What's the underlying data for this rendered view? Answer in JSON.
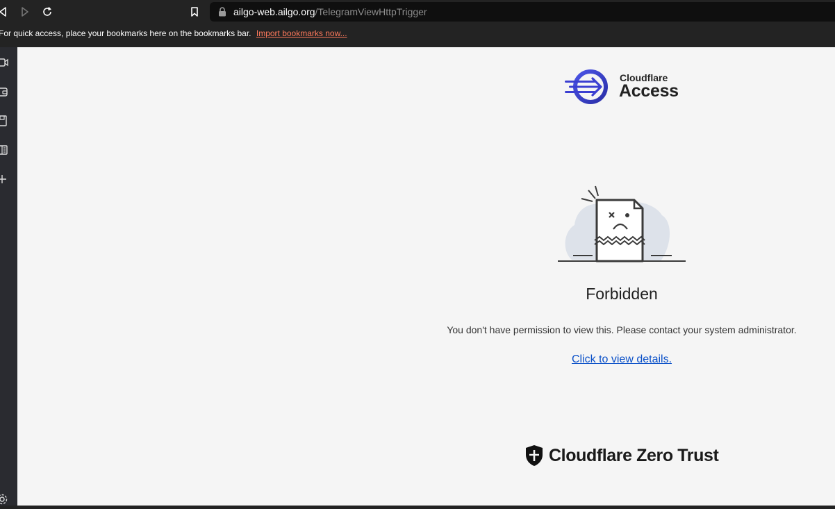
{
  "browser": {
    "url_host": "ailgo-web.ailgo.org",
    "url_path": "/TelegramViewHttpTrigger",
    "icons": [
      "back-icon",
      "forward-icon",
      "reload-icon",
      "bookmark-icon",
      "lock-icon"
    ]
  },
  "bookmarks_bar": {
    "message": "For quick access, place your bookmarks here on the bookmarks bar.",
    "import_link": "Import bookmarks now..."
  },
  "sidebar": {
    "icons": [
      "video-icon",
      "wallet-icon",
      "save-icon",
      "reader-icon",
      "add-icon",
      "settings-icon"
    ]
  },
  "page": {
    "logo_brand": "Cloudflare",
    "logo_product": "Access",
    "title": "Forbidden",
    "message": "You don't have permission to view this. Please contact your system administrator.",
    "details_link": "Click to view details.",
    "footer_logo": "Cloudflare Zero Trust"
  },
  "colors": {
    "accent": "#3b3fd1",
    "link": "#0a50c8",
    "bookmark_link": "#ff7a5c"
  }
}
